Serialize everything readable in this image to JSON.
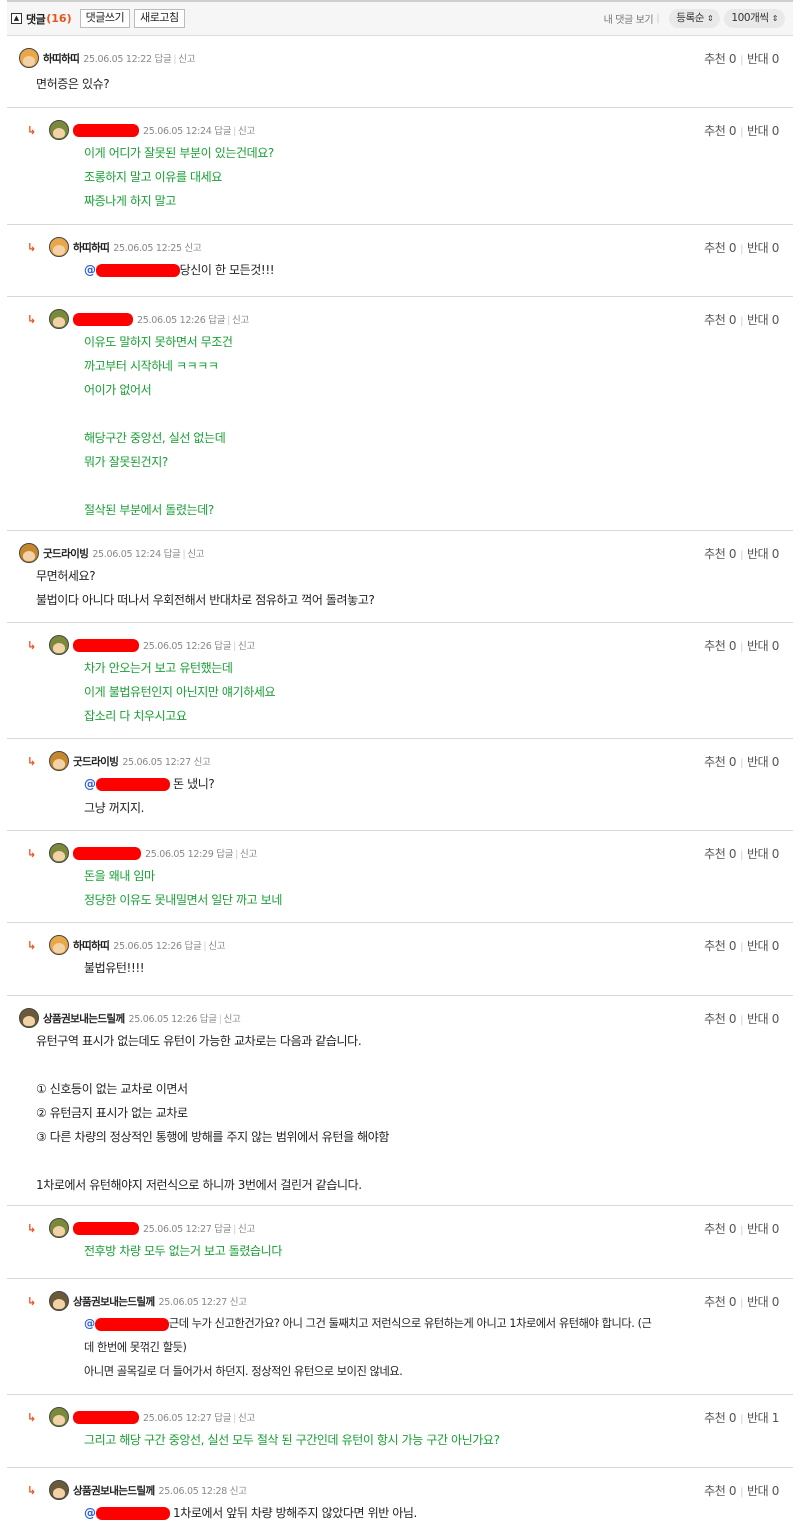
{
  "toolbar": {
    "title": "댓글",
    "count": "(16)",
    "write_label": "댓글쓰기",
    "refresh_label": "새로고침",
    "my_comments": "내 댓글 보기",
    "sort_value": "등록순",
    "page_size_value": "100개씩"
  },
  "labels": {
    "recommend": "추천",
    "oppose": "반대",
    "reply": "답글",
    "report": "신고"
  },
  "comments": [
    {
      "nick": "하띠하띠",
      "time": "25.06.05 12:22",
      "has_reply": true,
      "rec": "0",
      "opp": "0",
      "lines": [
        "면허증은 있슈?"
      ]
    },
    {
      "nick": "",
      "time": "25.06.05 12:24",
      "has_reply": true,
      "rec": "0",
      "opp": "0",
      "lines": [
        "이게 어디가 잘못된 부분이 있는건데요?",
        "조롱하지 말고 이유를 대세요",
        "짜증나게 하지 말고"
      ]
    },
    {
      "nick": "하띠하띠",
      "time": "25.06.05 12:25",
      "has_reply": false,
      "rec": "0",
      "opp": "0",
      "mention": "@",
      "lines": [
        "당신이 한 모든것!!!"
      ]
    },
    {
      "nick": "",
      "time": "25.06.05 12:26",
      "has_reply": true,
      "rec": "0",
      "opp": "0",
      "lines": [
        "이유도 말하지 못하면서 무조건",
        "까고부터 시작하네 ㅋㅋㅋㅋ",
        "어이가 없어서",
        "",
        "해당구간 중앙선, 실선 없는데",
        "뭐가 잘못된건지?",
        "",
        "절삭된 부분에서 돌렸는데?"
      ]
    },
    {
      "nick": "굿드라이빙",
      "time": "25.06.05 12:24",
      "has_reply": true,
      "rec": "0",
      "opp": "0",
      "lines": [
        "무면허세요?",
        "불법이다 아니다 떠나서 우회전해서 반대차로 점유하고 꺽어 돌려놓고?"
      ]
    },
    {
      "nick": "",
      "time": "25.06.05 12:26",
      "has_reply": true,
      "rec": "0",
      "opp": "0",
      "lines": [
        "차가 안오는거 보고 유턴했는데",
        "이게 불법유턴인지 아닌지만 얘기하세요",
        "잡소리 다 치우시고요"
      ]
    },
    {
      "nick": "굿드라이빙",
      "time": "25.06.05 12:27",
      "has_reply": false,
      "rec": "0",
      "opp": "0",
      "mention": "@",
      "lines": [
        " 돈 냈니?",
        "그냥 꺼지지."
      ]
    },
    {
      "nick": "",
      "time": "25.06.05 12:29",
      "has_reply": true,
      "rec": "0",
      "opp": "0",
      "lines": [
        "돈을 왜내 임마",
        "정당한 이유도 못내밀면서 일단 까고 보네"
      ]
    },
    {
      "nick": "하띠하띠",
      "time": "25.06.05 12:26",
      "has_reply": true,
      "rec": "0",
      "opp": "0",
      "lines": [
        "불법유턴!!!!"
      ]
    },
    {
      "nick": "상품권보내는드릴께",
      "time": "25.06.05 12:26",
      "has_reply": true,
      "rec": "0",
      "opp": "0",
      "lines": [
        "유턴구역 표시가 없는데도 유턴이 가능한 교차로는 다음과 같습니다.",
        "",
        "① 신호등이 없는 교차로 이면서",
        "② 유턴금지 표시가 없는 교차로",
        "③ 다른 차량의 정상적인 통행에 방해를 주지 않는 범위에서 유턴을 해야함",
        "",
        "1차로에서 유턴해야지 저런식으로 하니까 3번에서 걸린거 같습니다."
      ]
    },
    {
      "nick": "",
      "time": "25.06.05 12:27",
      "has_reply": true,
      "rec": "0",
      "opp": "0",
      "lines": [
        "전후방 차량 모두 없는거 보고 돌렸습니다"
      ]
    },
    {
      "nick": "상품권보내는드릴께",
      "time": "25.06.05 12:27",
      "has_reply": false,
      "rec": "0",
      "opp": "0",
      "mention": "@",
      "lines": [
        "근데 누가 신고한건가요? 아니 그건 둘째치고 저런식으로 유턴하는게 아니고 1차로에서 유턴해야 합니다. (근",
        "데 한번에 못꺾긴 할듯)",
        "아니면 골목길로 더 들어가서 하던지. 정상적인 유턴으로 보이진 않네요."
      ]
    },
    {
      "nick": "",
      "time": "25.06.05 12:27",
      "has_reply": true,
      "rec": "0",
      "opp": "1",
      "lines": [
        "그리고 해당 구간 중앙선, 실선 모두 절삭 된 구간인데 유턴이 항시 가능 구간 아닌가요?"
      ]
    },
    {
      "nick": "상품권보내는드릴께",
      "time": "25.06.05 12:28",
      "has_reply": false,
      "rec": "0",
      "opp": "0",
      "mention": "@",
      "lines": [
        " 1차로에서 앞뒤 차량 방해주지 않았다면 위반 아님."
      ]
    }
  ]
}
